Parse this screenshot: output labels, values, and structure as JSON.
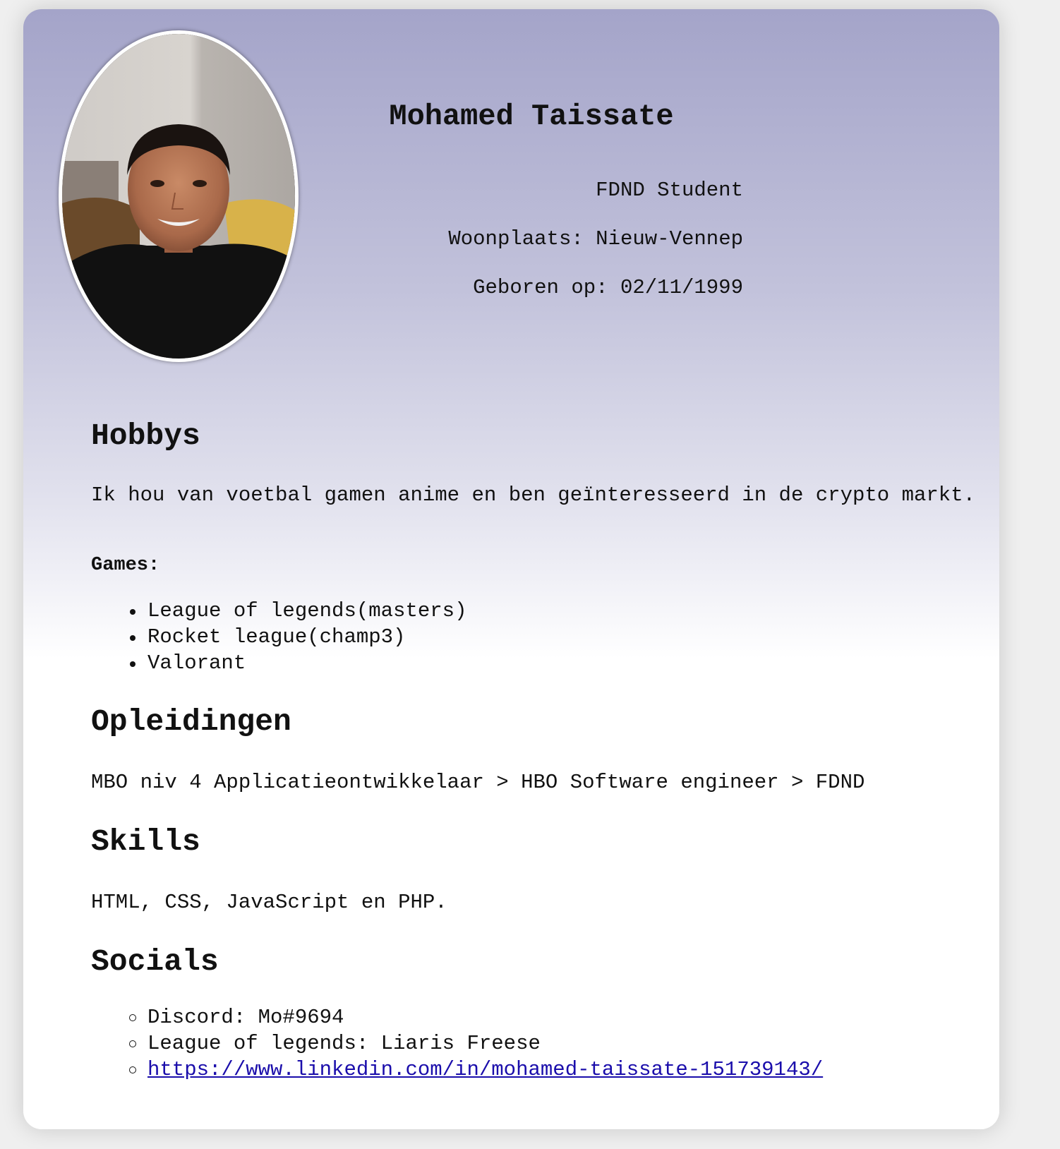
{
  "profile": {
    "name": "Mohamed Taissate",
    "role": "FDND Student",
    "residence": "Woonplaats: Nieuw-Vennep",
    "birth": "Geboren op: 02/11/1999"
  },
  "hobbies": {
    "heading": "Hobbys",
    "text": "Ik hou van voetbal gamen anime en ben geïnteresseerd in de crypto markt.",
    "games_label": "Games:",
    "games": [
      "League of legends(masters)",
      "Rocket league(champ3)",
      "Valorant"
    ]
  },
  "education": {
    "heading": "Opleidingen",
    "text": "MBO niv 4 Applicatieontwikkelaar > HBO Software engineer > FDND"
  },
  "skills": {
    "heading": "Skills",
    "text": "HTML, CSS, JavaScript en PHP."
  },
  "socials": {
    "heading": "Socials",
    "discord": "Discord: Mo#9694",
    "league": "League of legends: Liaris Freese",
    "linkedin": "https://www.linkedin.com/in/mohamed-taissate-151739143/"
  }
}
